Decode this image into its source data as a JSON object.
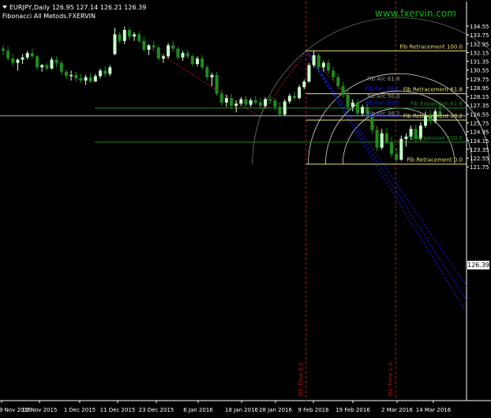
{
  "header": {
    "symbol_line": "EURJPY,Daily  126.95 127.14 126.21 126.39",
    "indicator_line": "Fibonacci All Metods.FXERVIN"
  },
  "watermark": "www.fxervin.com",
  "current_price_tag": "126.39",
  "colors": {
    "background": "#000000",
    "grid_text": "#ffffff",
    "candle_bull": "#c8ffc8",
    "candle_bear": "#1e8c1e",
    "retracement": "#e8e070",
    "expansion": "#1c8a1c",
    "arc": "#d8d8d8",
    "fan": "#1a1ae0",
    "time_zone": "#c01818",
    "watermark": "#00c000"
  },
  "chart_data": {
    "type": "candlestick",
    "y_axis_ticks": [
      "134.55",
      "133.75",
      "132.95",
      "132.15",
      "131.35",
      "130.55",
      "129.75",
      "128.95",
      "128.15",
      "127.35",
      "126.55",
      "125.75",
      "124.95",
      "124.15",
      "123.35",
      "122.55",
      "121.75"
    ],
    "ylim": [
      121.6,
      135.1
    ],
    "x_axis_labels": [
      "9 Nov 2015",
      "19 Nov 2015",
      "1 Dec 2015",
      "11 Dec 2015",
      "23 Dec 2015",
      "6 Jan 2016",
      "18 Jan 2016",
      "28 Jan 2016",
      "9 Feb 2016",
      "19 Feb 2016",
      "2 Mar 2016",
      "14 Mar 2016"
    ],
    "current_price": 126.39,
    "fib_retracement": [
      {
        "label": "Fib Retracement   100.0",
        "price": 132.3
      },
      {
        "label": "Fib Retracement   61.8",
        "price": 128.4
      },
      {
        "label": "Fib Retracement   38.2",
        "price": 126.0
      },
      {
        "label": "Fib Retracement   0.0",
        "price": 122.0
      }
    ],
    "fib_expansion": [
      {
        "label": "Fib Expansion   61.8",
        "price": 127.1
      },
      {
        "label": "Fib Expansion   100.0",
        "price": 124.0
      }
    ],
    "fib_arcs": [
      {
        "label": "Fib Arc   61.8",
        "ratio": 0.618
      },
      {
        "label": "Fib Arc   50.0",
        "ratio": 0.5
      },
      {
        "label": "Fib Arc   38.2",
        "ratio": 0.382
      }
    ],
    "fib_fan": [
      {
        "label": "Fib Fan   61.8"
      },
      {
        "label": "Fib Fan   50.0"
      },
      {
        "label": "Fib Fan   38.2"
      }
    ],
    "fib_time": [
      {
        "label": "Fib Time   0.0"
      },
      {
        "label": "Fib Time   1.0"
      }
    ],
    "candles": [
      [
        132.5,
        132.8,
        131.9,
        132.3
      ],
      [
        132.3,
        132.7,
        131.4,
        131.6
      ],
      [
        131.6,
        132.0,
        130.9,
        131.2
      ],
      [
        131.2,
        131.6,
        130.5,
        131.5
      ],
      [
        131.5,
        132.0,
        131.1,
        131.7
      ],
      [
        131.7,
        132.3,
        131.5,
        132.1
      ],
      [
        132.1,
        132.5,
        131.6,
        131.8
      ],
      [
        131.8,
        131.9,
        130.6,
        130.8
      ],
      [
        130.8,
        131.1,
        130.4,
        131.0
      ],
      [
        131.0,
        131.2,
        130.5,
        130.7
      ],
      [
        130.7,
        131.7,
        130.6,
        131.5
      ],
      [
        131.5,
        131.8,
        130.8,
        131.2
      ],
      [
        131.2,
        131.4,
        130.1,
        130.4
      ],
      [
        130.4,
        130.6,
        129.7,
        130.0
      ],
      [
        130.0,
        130.5,
        129.6,
        130.1
      ],
      [
        130.1,
        130.4,
        129.5,
        129.8
      ],
      [
        129.8,
        130.2,
        129.4,
        129.6
      ],
      [
        129.6,
        130.1,
        129.2,
        129.9
      ],
      [
        129.9,
        130.3,
        129.4,
        129.5
      ],
      [
        129.5,
        130.2,
        129.5,
        130.0
      ],
      [
        130.0,
        130.7,
        129.8,
        130.5
      ],
      [
        130.5,
        130.9,
        129.9,
        130.2
      ],
      [
        130.2,
        131.0,
        130.0,
        130.8
      ],
      [
        132.0,
        134.4,
        131.9,
        133.8
      ],
      [
        133.8,
        134.0,
        133.0,
        133.2
      ],
      [
        133.2,
        134.5,
        132.9,
        134.2
      ],
      [
        134.2,
        134.4,
        133.3,
        133.6
      ],
      [
        133.6,
        134.0,
        133.2,
        133.8
      ],
      [
        133.8,
        134.1,
        133.0,
        133.2
      ],
      [
        133.2,
        133.6,
        132.2,
        132.4
      ],
      [
        132.4,
        132.9,
        131.9,
        132.8
      ],
      [
        132.8,
        133.2,
        132.4,
        132.6
      ],
      [
        132.6,
        132.8,
        131.4,
        131.6
      ],
      [
        131.6,
        132.0,
        131.2,
        131.8
      ],
      [
        131.8,
        133.0,
        131.6,
        132.8
      ],
      [
        132.8,
        133.2,
        132.2,
        132.5
      ],
      [
        132.5,
        132.7,
        131.5,
        131.7
      ],
      [
        131.7,
        132.3,
        131.4,
        132.1
      ],
      [
        132.1,
        132.4,
        131.6,
        131.8
      ],
      [
        131.8,
        132.0,
        130.9,
        131.1
      ],
      [
        131.1,
        131.8,
        130.9,
        131.6
      ],
      [
        131.6,
        131.9,
        130.6,
        130.8
      ],
      [
        130.8,
        131.0,
        129.6,
        129.9
      ],
      [
        129.9,
        130.3,
        129.1,
        130.1
      ],
      [
        130.1,
        130.4,
        128.2,
        128.4
      ],
      [
        128.4,
        128.8,
        127.3,
        127.6
      ],
      [
        127.6,
        128.3,
        127.2,
        128.0
      ],
      [
        128.0,
        128.4,
        127.0,
        127.3
      ],
      [
        127.3,
        127.8,
        126.7,
        127.5
      ],
      [
        127.5,
        128.1,
        127.3,
        127.9
      ],
      [
        127.9,
        128.2,
        127.2,
        127.4
      ],
      [
        127.4,
        128.0,
        127.2,
        127.8
      ],
      [
        127.8,
        128.2,
        127.4,
        127.6
      ],
      [
        127.6,
        128.0,
        127.0,
        127.3
      ],
      [
        127.3,
        128.1,
        127.1,
        127.9
      ],
      [
        127.9,
        128.2,
        127.5,
        127.8
      ],
      [
        127.8,
        128.0,
        126.9,
        127.2
      ],
      [
        127.2,
        127.6,
        126.3,
        126.5
      ],
      [
        126.5,
        127.9,
        126.4,
        127.7
      ],
      [
        127.7,
        128.4,
        127.5,
        128.2
      ],
      [
        128.2,
        128.6,
        127.8,
        128.0
      ],
      [
        128.0,
        129.2,
        127.9,
        129.0
      ],
      [
        129.0,
        129.7,
        128.8,
        129.5
      ],
      [
        129.5,
        131.2,
        129.4,
        131.0
      ],
      [
        131.0,
        132.3,
        130.8,
        131.9
      ],
      [
        131.9,
        132.1,
        130.5,
        130.8
      ],
      [
        130.8,
        131.4,
        130.4,
        131.2
      ],
      [
        131.2,
        131.5,
        130.2,
        130.5
      ],
      [
        130.5,
        130.8,
        129.6,
        129.9
      ],
      [
        129.9,
        130.2,
        128.8,
        129.1
      ],
      [
        129.1,
        129.5,
        128.0,
        128.3
      ],
      [
        128.3,
        128.8,
        126.9,
        127.2
      ],
      [
        127.2,
        127.9,
        126.8,
        127.6
      ],
      [
        127.6,
        127.9,
        126.3,
        126.6
      ],
      [
        126.6,
        127.4,
        126.4,
        127.2
      ],
      [
        127.2,
        127.5,
        126.0,
        126.3
      ],
      [
        126.3,
        126.6,
        124.8,
        125.1
      ],
      [
        125.1,
        125.5,
        123.2,
        123.5
      ],
      [
        123.5,
        125.2,
        123.3,
        124.8
      ],
      [
        124.8,
        125.3,
        123.8,
        124.0
      ],
      [
        124.0,
        124.5,
        122.6,
        122.9
      ],
      [
        122.9,
        123.5,
        122.2,
        122.4
      ],
      [
        122.4,
        124.6,
        122.3,
        124.3
      ],
      [
        124.3,
        124.8,
        123.6,
        124.5
      ],
      [
        124.5,
        125.5,
        124.2,
        125.2
      ],
      [
        125.2,
        125.6,
        124.0,
        124.3
      ],
      [
        124.3,
        125.8,
        124.1,
        125.5
      ],
      [
        125.5,
        126.8,
        125.3,
        126.4
      ],
      [
        126.4,
        126.9,
        125.6,
        125.9
      ],
      [
        125.9,
        127.0,
        125.7,
        126.8
      ],
      [
        126.8,
        127.4,
        126.2,
        126.4
      ]
    ]
  }
}
